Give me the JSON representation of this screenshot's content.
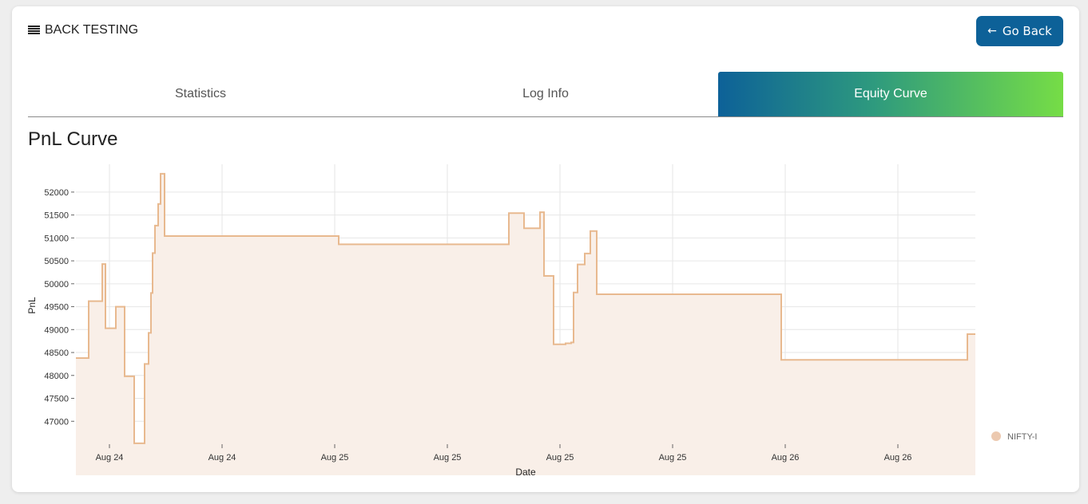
{
  "header": {
    "title": "BACK TESTING",
    "menu_icon": "hamburger-icon"
  },
  "go_back": {
    "label": "Go Back",
    "icon": "arrow-left-icon"
  },
  "tabs": [
    {
      "label": "Statistics",
      "active": false
    },
    {
      "label": "Log Info",
      "active": false
    },
    {
      "label": "Equity Curve",
      "active": true
    }
  ],
  "section": {
    "title": "PnL Curve"
  },
  "colors": {
    "accent": "#0d6198",
    "series_line": "#e8b98f",
    "series_fill": "#f9efe8",
    "gradient_end": "#76dd46"
  },
  "chart_data": {
    "type": "area",
    "step": true,
    "xlabel": "Date",
    "ylabel": "PnL",
    "ylim": [
      46500,
      52450
    ],
    "xlim": [
      0,
      1126
    ],
    "yticks": [
      47000,
      47500,
      48000,
      48500,
      49000,
      49500,
      50000,
      50500,
      51000,
      51500,
      52000
    ],
    "xticks": [
      {
        "pos": 42,
        "label": "Aug 24"
      },
      {
        "pos": 183,
        "label": "Aug 24"
      },
      {
        "pos": 324,
        "label": "Aug 25"
      },
      {
        "pos": 465,
        "label": "Aug 25"
      },
      {
        "pos": 606,
        "label": "Aug 25"
      },
      {
        "pos": 747,
        "label": "Aug 25"
      },
      {
        "pos": 888,
        "label": "Aug 26"
      },
      {
        "pos": 1029,
        "label": "Aug 26"
      }
    ],
    "grid": true,
    "legend_position": "right",
    "series": [
      {
        "name": "NIFTY-I",
        "points": [
          [
            0,
            48380
          ],
          [
            16,
            49620
          ],
          [
            33,
            50430
          ],
          [
            37,
            49030
          ],
          [
            50,
            49500
          ],
          [
            61,
            47980
          ],
          [
            73,
            46520
          ],
          [
            86,
            48250
          ],
          [
            91,
            48930
          ],
          [
            94,
            49800
          ],
          [
            96,
            50670
          ],
          [
            99,
            51270
          ],
          [
            103,
            51740
          ],
          [
            106,
            52400
          ],
          [
            111,
            51040
          ],
          [
            329,
            50860
          ],
          [
            542,
            51540
          ],
          [
            561,
            51210
          ],
          [
            581,
            51560
          ],
          [
            586,
            50170
          ],
          [
            598,
            48680
          ],
          [
            613,
            48700
          ],
          [
            620,
            48720
          ],
          [
            623,
            49810
          ],
          [
            628,
            50420
          ],
          [
            637,
            50660
          ],
          [
            644,
            51150
          ],
          [
            652,
            49770
          ],
          [
            883,
            48340
          ],
          [
            1116,
            48900
          ],
          [
            1126,
            48900
          ]
        ]
      }
    ]
  }
}
